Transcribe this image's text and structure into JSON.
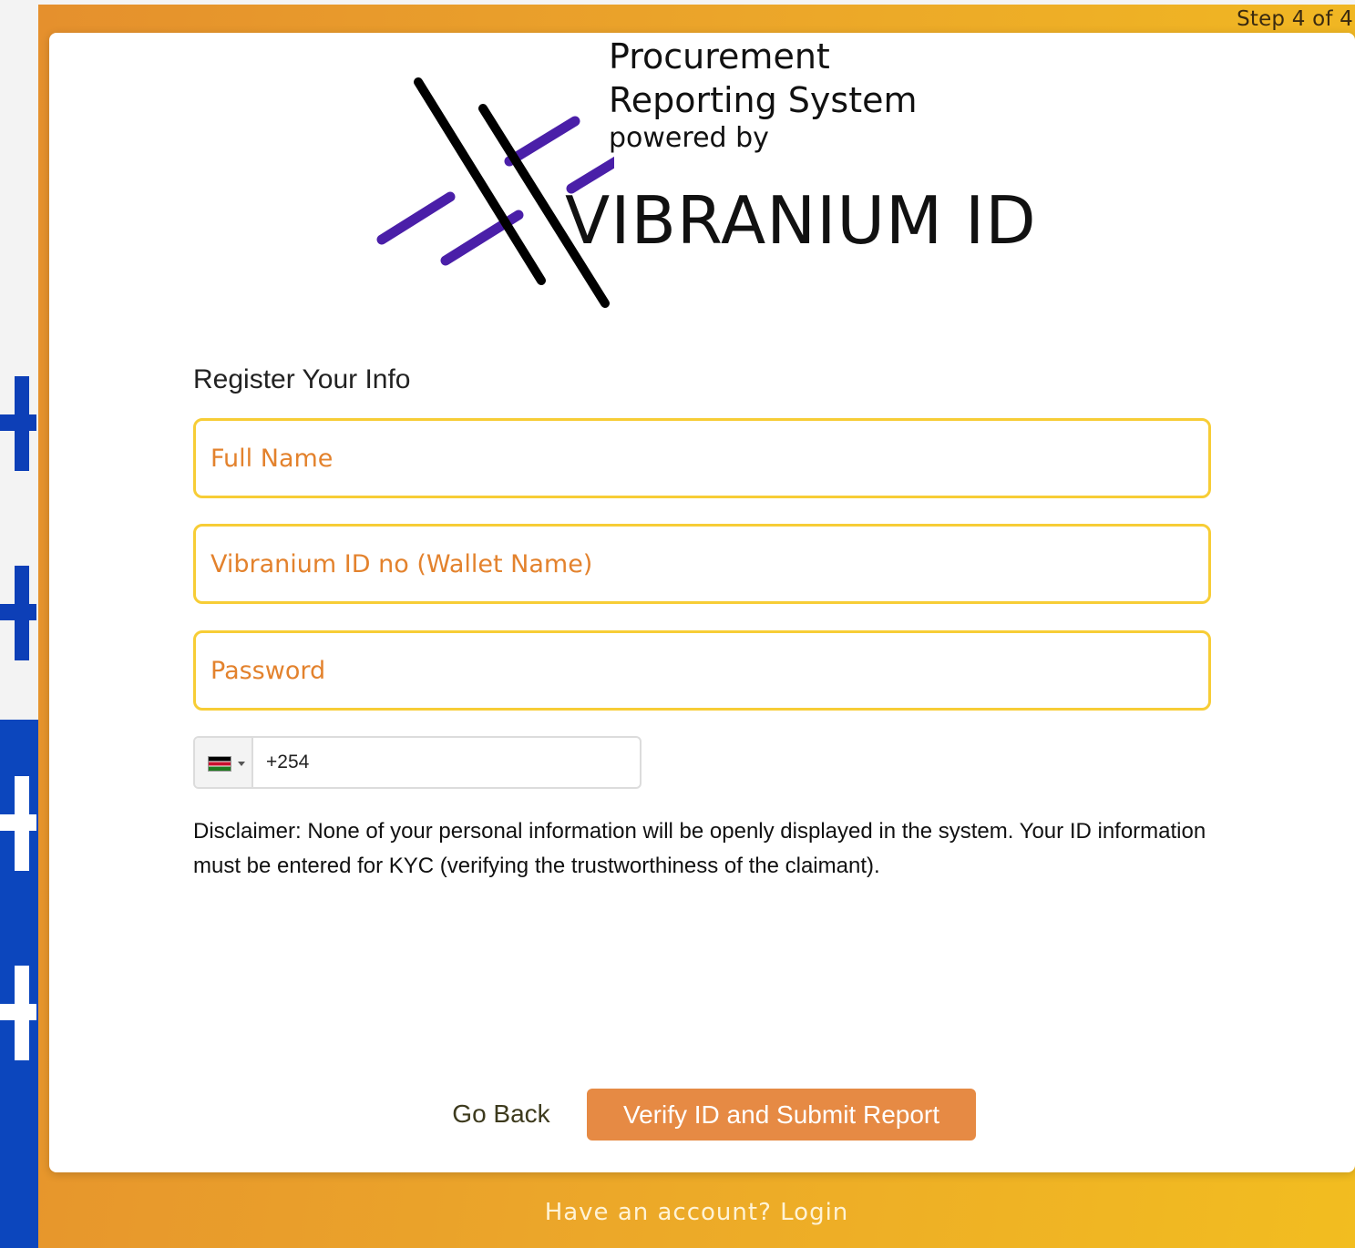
{
  "header": {
    "step_indicator": "Step 4 of 4"
  },
  "logo": {
    "line1": "Procurement",
    "line2": "Reporting System",
    "line3": "powered by",
    "brand": "VIBRANIUM ID",
    "colors": {
      "black": "#000000",
      "purple": "#4a1fa8"
    }
  },
  "form": {
    "title": "Register Your Info",
    "full_name_placeholder": "Full Name",
    "vibranium_id_placeholder": "Vibranium ID no (Wallet Name)",
    "password_placeholder": "Password",
    "phone": {
      "country": "Kenya",
      "value": "+254"
    },
    "disclaimer": "Disclaimer: None of your personal information will be openly displayed in the system. Your ID information must be entered for KYC (verifying the trustworthiness of the claimant).",
    "go_back_label": "Go Back",
    "submit_label": "Verify ID and Submit Report"
  },
  "footer": {
    "prompt": "Have an account?",
    "login_label": "Login"
  },
  "theme": {
    "accent": "#e68a44",
    "field_border": "#f7cd36",
    "placeholder": "#e3822d",
    "side_blue": "#0c46bd"
  }
}
